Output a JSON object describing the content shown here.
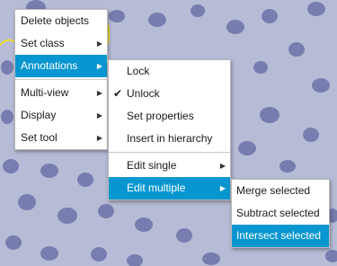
{
  "main_menu": {
    "items": [
      {
        "label": "Delete objects"
      },
      {
        "label": "Set class"
      },
      {
        "label": "Annotations"
      },
      {
        "label": "Multi-view"
      },
      {
        "label": "Display"
      },
      {
        "label": "Set tool"
      }
    ]
  },
  "annotations_menu": {
    "items": [
      {
        "label": "Lock"
      },
      {
        "label": "Unlock",
        "checked": true
      },
      {
        "label": "Set properties"
      },
      {
        "label": "Insert in hierarchy"
      },
      {
        "label": "Edit single"
      },
      {
        "label": "Edit multiple"
      }
    ]
  },
  "edit_multiple_menu": {
    "items": [
      {
        "label": "Merge selected"
      },
      {
        "label": "Subtract selected"
      },
      {
        "label": "Intersect selected"
      }
    ]
  },
  "colors": {
    "selection": "#0896d0",
    "background_tissue": "#b8bdd8",
    "annotation_line": "#ffe600"
  }
}
